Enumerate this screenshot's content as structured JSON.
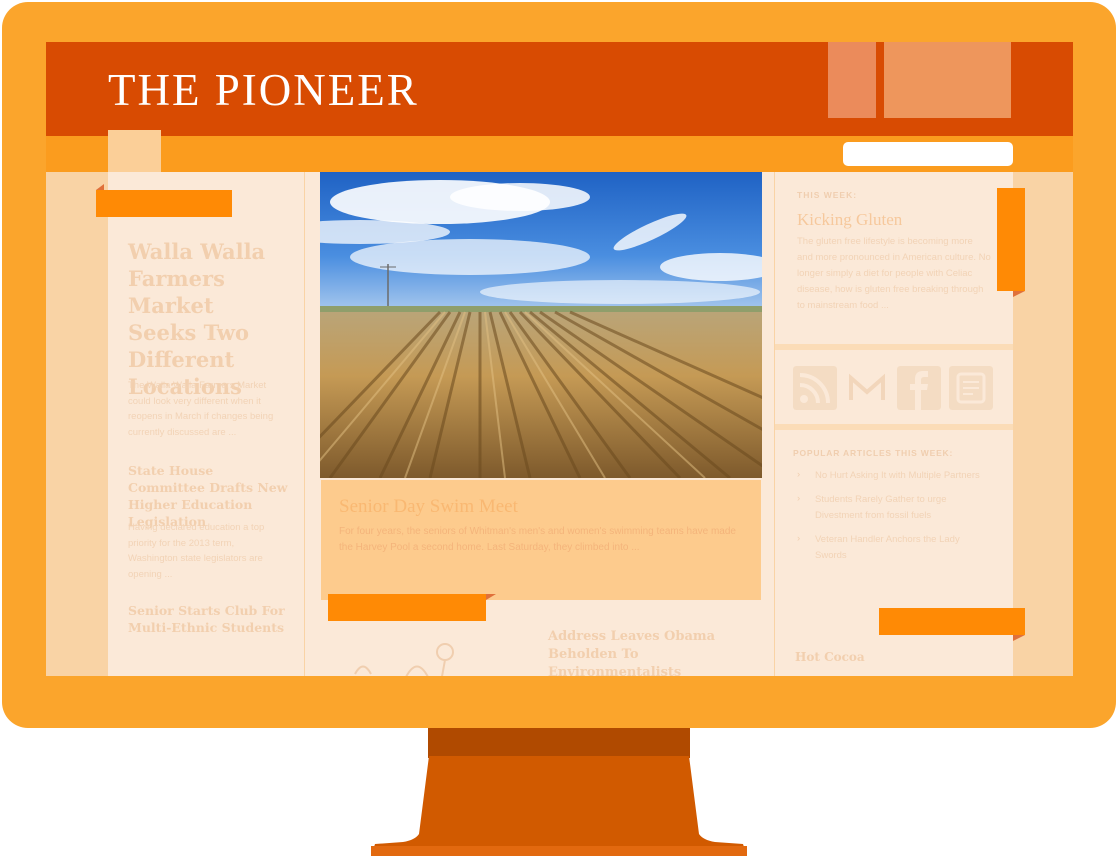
{
  "site": {
    "title": "THE PIONEER"
  },
  "left_column": {
    "lead_headline": "Walla Walla Farmers Market Seeks Two Different Locations",
    "lead_summary": "The Walla Walla Farmers Market could look very different when it reopens in March if changes being currently discussed are ...",
    "story2_headline": "State House Committee Drafts New Higher Education Legislation",
    "story2_summary": "Having declared education a top priority for the 2013 term, Washington state legislators are opening ...",
    "story3_headline": "Senior Starts Club For Multi-Ethnic Students"
  },
  "feature": {
    "title": "Senior Day Swim Meet",
    "summary": "For four years, the seniors of Whitman's men's and women's swimming teams have made the Harvey Pool a second home. Last Saturday, they climbed into ..."
  },
  "lower": {
    "headline": "Address Leaves Obama Beholden To Environmentalists"
  },
  "right_column": {
    "week_label": "THIS WEEK:",
    "week_title": "Kicking Gluten",
    "week_summary": "The gluten free lifestyle is becoming more and more pronounced in American culture. No longer simply a diet for people with Celiac disease, how is gluten free breaking through to mainstream food ...",
    "social_icons": [
      "rss-icon",
      "gmail-icon",
      "facebook-icon",
      "bookmark-icon"
    ],
    "popular_label": "POPULAR ARTICLES THIS WEEK:",
    "popular": [
      "No Hurt Asking It with Multiple Partners",
      "Students Rarely Gather to urge Divestment from fossil fuels",
      "Veteran Handler Anchors the Lady Swords"
    ],
    "bottom_headline": "Hot Cocoa"
  },
  "colors": {
    "monitor_frame": "#fba52c",
    "masthead": "#d84b02",
    "navbar": "#fb9c1e",
    "ribbon": "#ff8a05",
    "stand": "#d15a00"
  }
}
